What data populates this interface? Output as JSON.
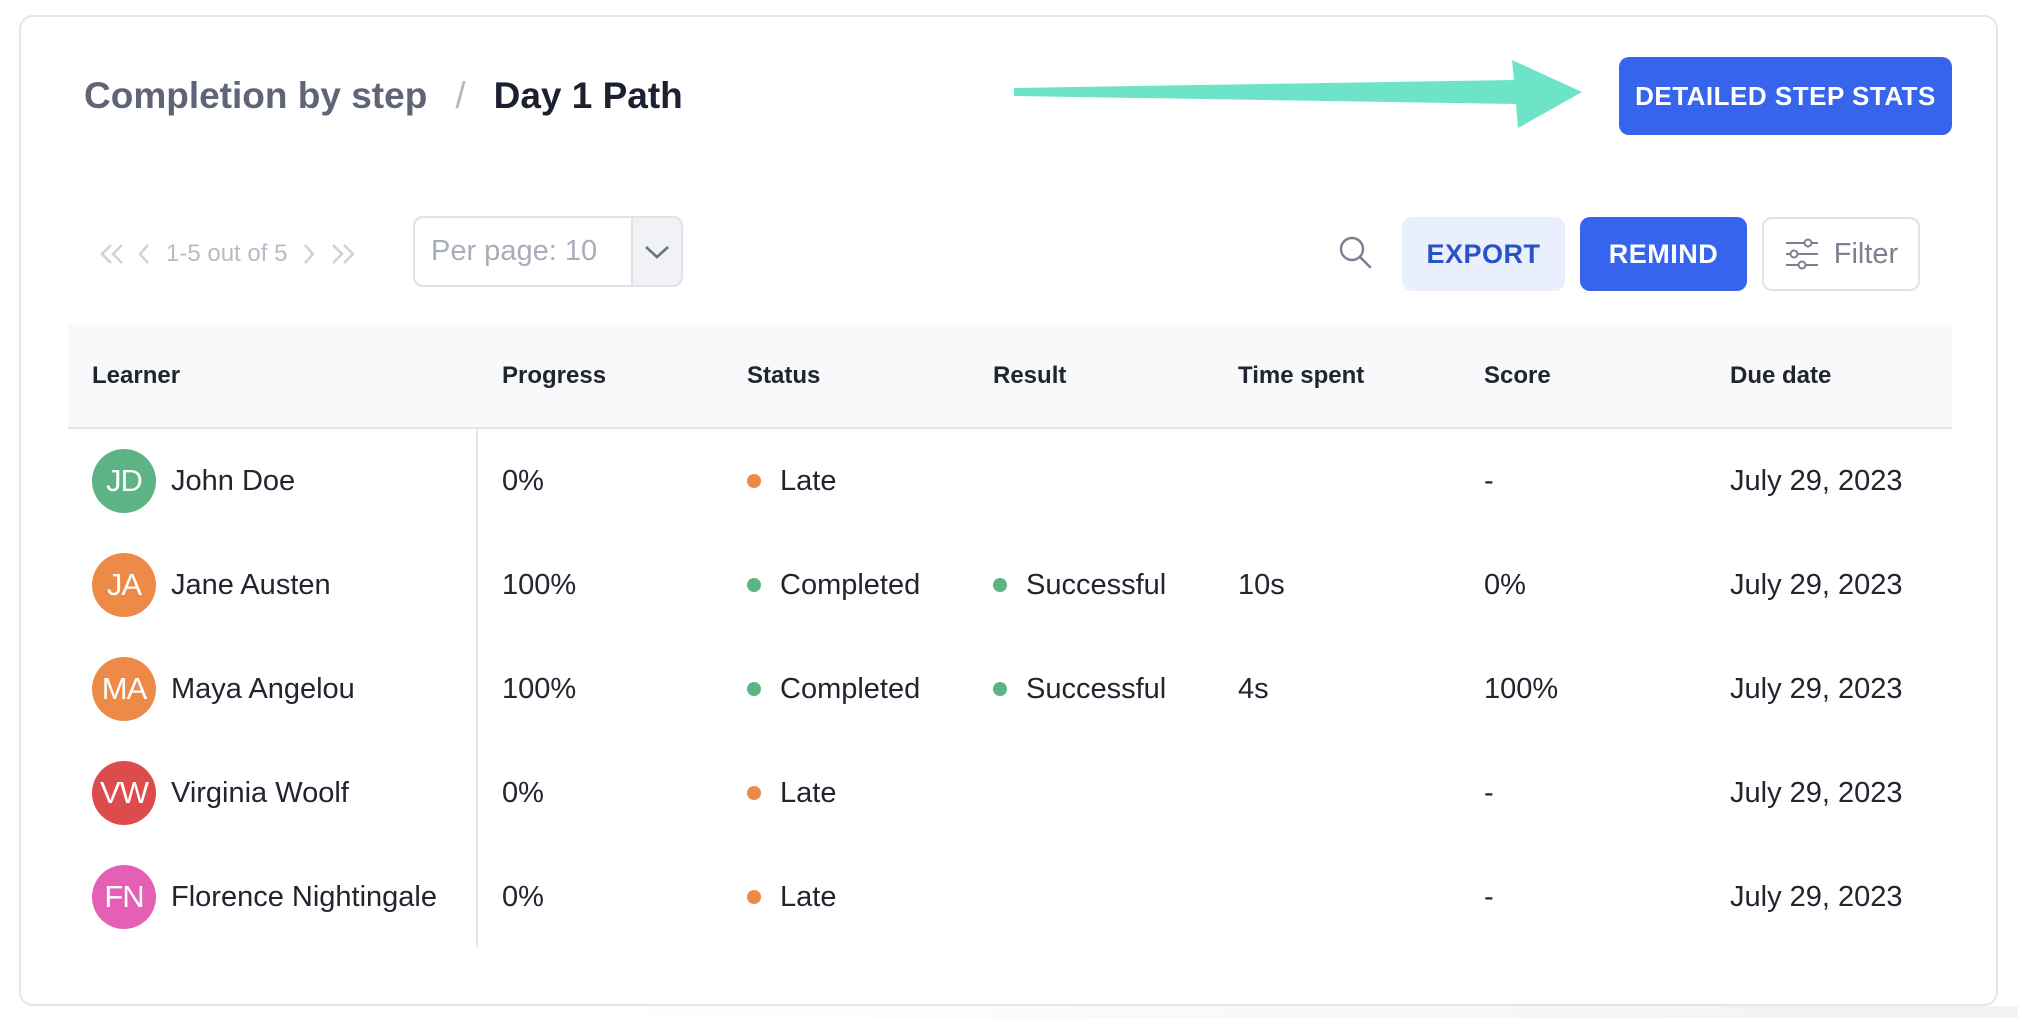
{
  "header": {
    "breadcrumb_parent": "Completion by step",
    "breadcrumb_separator": "/",
    "breadcrumb_current": "Day 1 Path"
  },
  "annotation": {
    "arrow_color": "#6de3c8"
  },
  "buttons": {
    "detailed_step_stats": "DETAILED STEP STATS",
    "export": "EXPORT",
    "remind": "REMIND",
    "filter": "Filter"
  },
  "pagination": {
    "range_text": "1-5 out of 5",
    "per_page_label": "Per page: 10"
  },
  "icons": {
    "search": "search-icon",
    "filter": "sliders-icon",
    "per_page_dropdown": "chevron-down-icon",
    "first_page": "double-chevron-left-icon",
    "prev_page": "chevron-left-icon",
    "next_page": "chevron-right-icon",
    "last_page": "double-chevron-right-icon"
  },
  "colors": {
    "primary": "#3764ec",
    "status_late": "#ee8a48",
    "status_completed": "#5db383",
    "result_successful": "#5db383"
  },
  "table": {
    "columns": [
      "Learner",
      "Progress",
      "Status",
      "Result",
      "Time spent",
      "Score",
      "Due date"
    ],
    "rows": [
      {
        "initials": "JD",
        "avatar_color": "#5db383",
        "name": "John Doe",
        "progress": "0%",
        "status": "Late",
        "status_color": "#ee8a48",
        "result": "",
        "result_color": "",
        "time_spent": "",
        "score": "-",
        "due_date": "July 29, 2023"
      },
      {
        "initials": "JA",
        "avatar_color": "#ee8a48",
        "name": "Jane Austen",
        "progress": "100%",
        "status": "Completed",
        "status_color": "#5db383",
        "result": "Successful",
        "result_color": "#5db383",
        "time_spent": "10s",
        "score": "0%",
        "due_date": "July 29, 2023"
      },
      {
        "initials": "MA",
        "avatar_color": "#ee8a48",
        "name": "Maya Angelou",
        "progress": "100%",
        "status": "Completed",
        "status_color": "#5db383",
        "result": "Successful",
        "result_color": "#5db383",
        "time_spent": "4s",
        "score": "100%",
        "due_date": "July 29, 2023"
      },
      {
        "initials": "VW",
        "avatar_color": "#dc4c4c",
        "name": "Virginia Woolf",
        "progress": "0%",
        "status": "Late",
        "status_color": "#ee8a48",
        "result": "",
        "result_color": "",
        "time_spent": "",
        "score": "-",
        "due_date": "July 29, 2023"
      },
      {
        "initials": "FN",
        "avatar_color": "#e55fb5",
        "name": "Florence Nightingale",
        "progress": "0%",
        "status": "Late",
        "status_color": "#ee8a48",
        "result": "",
        "result_color": "",
        "time_spent": "",
        "score": "-",
        "due_date": "July 29, 2023"
      }
    ]
  }
}
